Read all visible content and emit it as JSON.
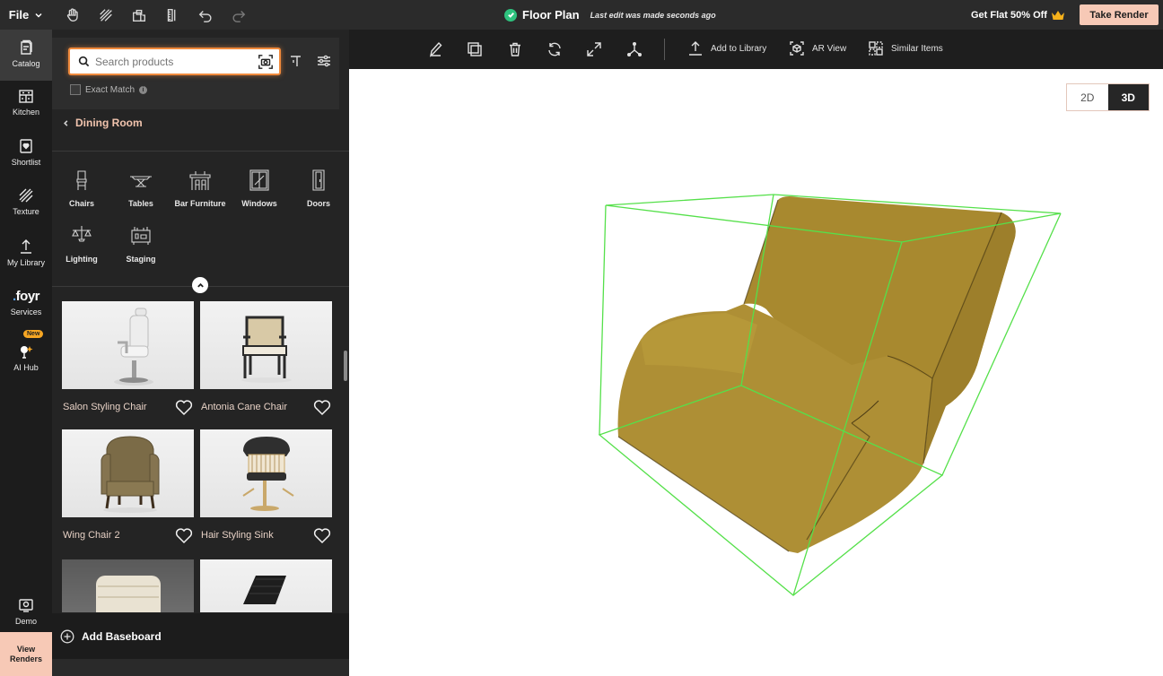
{
  "topbar": {
    "file_label": "File",
    "title": "Floor Plan",
    "last_edit": "Last edit was made seconds ago",
    "promo": "Get Flat 50% Off",
    "take_render": "Take Render"
  },
  "rail": {
    "items": [
      {
        "label": "Catalog",
        "icon": "catalog-icon"
      },
      {
        "label": "Kitchen",
        "icon": "kitchen-icon"
      },
      {
        "label": "Shortlist",
        "icon": "shortlist-icon"
      },
      {
        "label": "Texture",
        "icon": "texture-icon"
      },
      {
        "label": "My Library",
        "icon": "upload-icon"
      },
      {
        "label": "Services",
        "icon": "foyr-logo"
      },
      {
        "label": "AI Hub",
        "icon": "ai-hub-icon"
      },
      {
        "label": "Demo",
        "icon": "demo-icon"
      }
    ],
    "foyr_logo": "foyr",
    "new_badge": "New",
    "view_renders": "View Renders"
  },
  "panel": {
    "search_placeholder": "Search products",
    "exact_match": "Exact Match",
    "breadcrumb": "Dining Room",
    "categories": [
      {
        "label": "Chairs",
        "icon": "chair-icon"
      },
      {
        "label": "Tables",
        "icon": "table-icon"
      },
      {
        "label": "Bar Furniture",
        "icon": "bar-furniture-icon"
      },
      {
        "label": "Windows",
        "icon": "window-icon"
      },
      {
        "label": "Doors",
        "icon": "door-icon"
      },
      {
        "label": "Lighting",
        "icon": "lighting-icon"
      },
      {
        "label": "Staging",
        "icon": "staging-icon"
      }
    ],
    "products": [
      {
        "name": "Salon Styling Chair"
      },
      {
        "name": "Antonia Cane Chair"
      },
      {
        "name": "Wing Chair 2"
      },
      {
        "name": "Hair Styling Sink"
      }
    ],
    "add_baseboard": "Add Baseboard"
  },
  "canvas_toolbar": {
    "add_to_library": "Add to Library",
    "ar_view": "AR View",
    "similar_items": "Similar Items"
  },
  "view_toggle": {
    "option_2d": "2D",
    "option_3d": "3D",
    "selected": "3D"
  },
  "colors": {
    "accent": "#f7c9b6",
    "search_glow": "#f08a3c",
    "selection_box": "#55e04a",
    "sofa": "#a8892f"
  }
}
